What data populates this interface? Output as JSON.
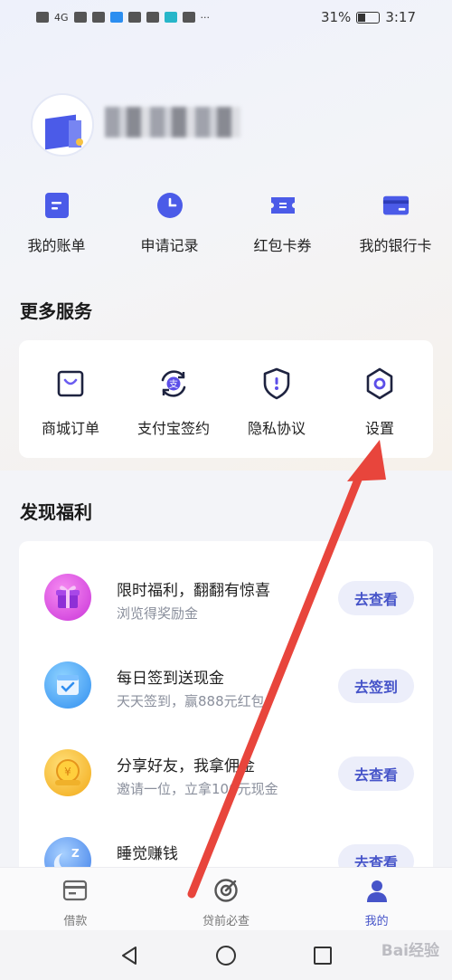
{
  "status_bar": {
    "network": "4G",
    "battery": "31%",
    "time": "3:17"
  },
  "profile": {
    "username": "user"
  },
  "quick_actions": [
    {
      "label": "我的账单",
      "icon": "bill-icon"
    },
    {
      "label": "申请记录",
      "icon": "clock-icon"
    },
    {
      "label": "红包卡券",
      "icon": "coupon-icon"
    },
    {
      "label": "我的银行卡",
      "icon": "bank-card-icon"
    }
  ],
  "more_services": {
    "title": "更多服务",
    "items": [
      {
        "label": "商城订单",
        "icon": "shopping-bag-icon"
      },
      {
        "label": "支付宝签约",
        "icon": "alipay-icon"
      },
      {
        "label": "隐私协议",
        "icon": "shield-icon"
      },
      {
        "label": "设置",
        "icon": "gear-icon"
      }
    ]
  },
  "welfare": {
    "title": "发现福利",
    "items": [
      {
        "title": "限时福利，翻翻有惊喜",
        "subtitle": "浏览得奖励金",
        "button": "去查看",
        "icon": "gift-icon",
        "color": "#d94fe0"
      },
      {
        "title": "每日签到送现金",
        "subtitle": "天天签到，赢888元红包",
        "button": "去签到",
        "icon": "calendar-icon",
        "color": "#3a9bf0"
      },
      {
        "title": "分享好友，我拿佣金",
        "subtitle": "邀请一位，立拿100元现金",
        "button": "去查看",
        "icon": "coin-icon",
        "color": "#f2b31e"
      },
      {
        "title": "睡觉赚钱",
        "subtitle": "",
        "button": "去查看",
        "icon": "moon-icon",
        "color": "#3d7de8"
      }
    ]
  },
  "tabbar": [
    {
      "label": "借款",
      "icon": "loan-icon",
      "active": false
    },
    {
      "label": "贷前必查",
      "icon": "target-icon",
      "active": false
    },
    {
      "label": "我的",
      "icon": "person-icon",
      "active": true
    }
  ],
  "watermark": "Bai经验",
  "colors": {
    "accent": "#4654c9",
    "arrow": "#e8453c"
  }
}
